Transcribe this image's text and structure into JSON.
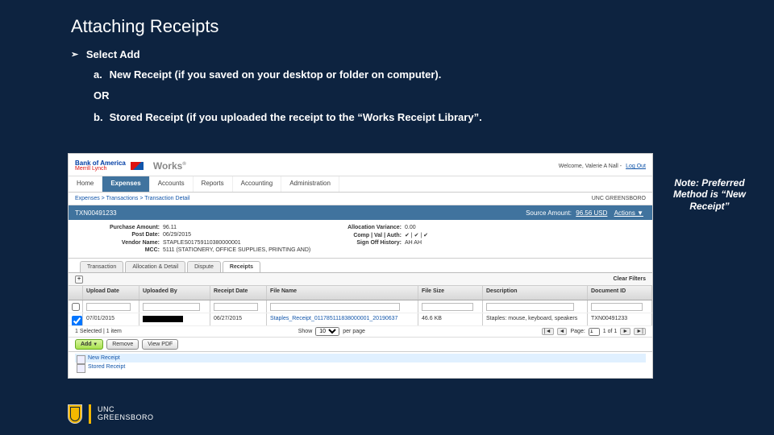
{
  "slide": {
    "title": "Attaching Receipts",
    "bullet": "Select Add",
    "item_a_label": "a.",
    "item_a_text": "New Receipt (if you saved on your desktop or folder on computer).",
    "or": "OR",
    "item_b_label": "b.",
    "item_b_text": "Stored Receipt (if you uploaded the receipt to the “Works Receipt Library”.",
    "note": "Note: Preferred Method is “New Receipt”"
  },
  "footer": {
    "line1": "UNC",
    "line2": "GREENSBORO"
  },
  "screenshot": {
    "brand_top": "Bank of America",
    "brand_bottom": "Merrill Lynch",
    "product": "Works",
    "product_reg": "®",
    "welcome_prefix": "Welcome, ",
    "welcome_name": "Valerie A Nall",
    "logout": "Log Out",
    "nav": [
      "Home",
      "Expenses",
      "Accounts",
      "Reports",
      "Accounting",
      "Administration"
    ],
    "nav_active_index": 1,
    "breadcrumb": "Expenses > Transactions > Transaction Detail",
    "org": "UNC GREENSBORO",
    "txn_id": "TXN00491233",
    "source_label": "Source Amount:",
    "source_value": "96.56 USD",
    "actions_label": "Actions ▼",
    "details": {
      "purchase_amount_label": "Purchase Amount:",
      "purchase_amount": "96.11",
      "post_date_label": "Post Date:",
      "post_date": "06/29/2015",
      "vendor_name_label": "Vendor Name:",
      "vendor_name": "STAPLES01759110380000001",
      "mcc_label": "MCC:",
      "mcc": "5111 (STATIONERY, OFFICE SUPPLIES, PRINTING AND)",
      "alloc_var_label": "Allocation Variance:",
      "alloc_var": "0.00",
      "comp_label": "Comp | Val | Auth:",
      "comp_val": "✔ | ✔ | ✔",
      "signoff_label": "Sign Off History:",
      "signoff": "AH AH"
    },
    "subtabs": [
      "Transaction",
      "Allocation & Detail",
      "Dispute",
      "Receipts"
    ],
    "subtab_active_index": 3,
    "clear_filters": "Clear Filters",
    "columns": [
      "",
      "Upload Date",
      "Uploaded By",
      "Receipt Date",
      "File Name",
      "File Size",
      "Description",
      "Document ID"
    ],
    "row": {
      "upload_date": "07/01/2015",
      "receipt_date": "06/27/2015",
      "file_name": "Staples_Receipt_011785111838000001_20190637",
      "file_size": "46.6 KB",
      "description": "Staples: mouse, keyboard, speakers",
      "document_id": "TXN00491233"
    },
    "selected_text": "1 Selected | 1 item",
    "show_label": "Show",
    "per_page_options": "10",
    "per_page_suffix": "per page",
    "page_label": "Page:",
    "page_of": "1 of 1",
    "action_buttons": {
      "add": "Add",
      "remove": "Remove",
      "view_pdf": "View PDF"
    },
    "add_menu": [
      "New Receipt",
      "Stored Receipt"
    ]
  }
}
